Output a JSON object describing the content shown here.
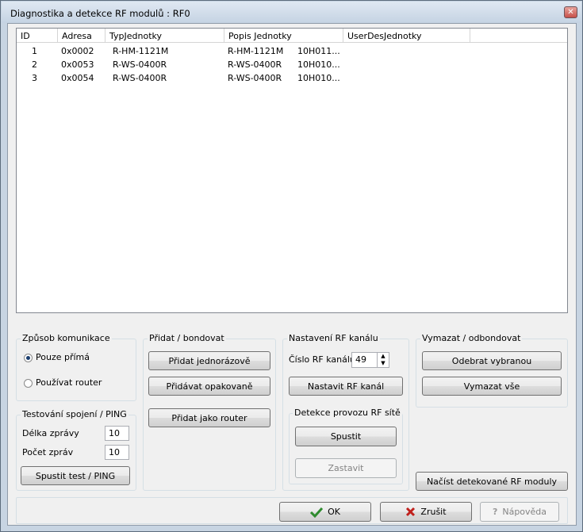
{
  "window": {
    "title": "Diagnostika a detekce RF modulů : RF0",
    "close_glyph": "✕"
  },
  "list": {
    "columns": [
      "ID",
      "Adresa",
      "TypJednotky",
      "Popis Jednotky",
      "UserDesJednotky"
    ],
    "rows": [
      {
        "id": "1",
        "adresa": "0x0002",
        "typ": "R-HM-1121M",
        "popis": "R-HM-1121M",
        "extra": "10H011..."
      },
      {
        "id": "2",
        "adresa": "0x0053",
        "typ": "R-WS-0400R",
        "popis": "R-WS-0400R",
        "extra": "10H010..."
      },
      {
        "id": "3",
        "adresa": "0x0054",
        "typ": "R-WS-0400R",
        "popis": "R-WS-0400R",
        "extra": "10H010..."
      }
    ]
  },
  "comm": {
    "title": "Způsob komunikace",
    "direct": "Pouze přímá",
    "router": "Používat router"
  },
  "ping": {
    "title": "Testování spojení / PING",
    "length_label": "Délka zprávy",
    "length_value": "10",
    "count_label": "Počet zpráv",
    "count_value": "10",
    "run": "Spustit test / PING"
  },
  "pair": {
    "title": "Přidat / bondovat",
    "once": "Přidat jednorázově",
    "repeat": "Přidávat opakovaně",
    "as_router": "Přidat jako router"
  },
  "rf": {
    "title": "Nastavení RF kanálu",
    "channel_label": "Číslo RF kanálu",
    "channel_value": "49",
    "set": "Nastavit RF kanál"
  },
  "detect": {
    "title": "Detekce provozu RF sítě",
    "start": "Spustit",
    "stop": "Zastavit"
  },
  "remove": {
    "title": "Vymazat / odbondovat",
    "selected": "Odebrat vybranou",
    "all": "Vymazat vše"
  },
  "load": "Načíst detekované RF moduly",
  "footer": {
    "ok": "OK",
    "cancel": "Zrušit",
    "help": "Nápověda"
  },
  "colors": {
    "ok_check": "#2e8b2e",
    "cancel_x": "#c0201c"
  }
}
